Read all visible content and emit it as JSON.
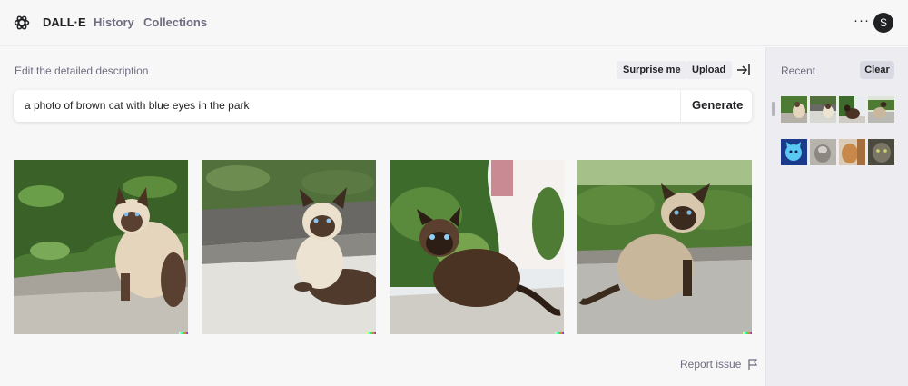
{
  "header": {
    "brand": "DALL·E",
    "nav": [
      "History",
      "Collections"
    ],
    "more_label": "···",
    "avatar_initial": "S"
  },
  "editor": {
    "heading": "Edit the detailed description",
    "surprise_label": "Surprise me",
    "upload_label": "Upload",
    "prompt_value": "a photo of brown cat with blue eyes in the park",
    "generate_label": "Generate"
  },
  "results": [
    {
      "icon": "siamese-cat-in-garden-image"
    },
    {
      "icon": "siamese-cat-on-sidewalk-image"
    },
    {
      "icon": "siamese-cat-near-hedge-image"
    },
    {
      "icon": "siamese-cat-on-pavement-image"
    }
  ],
  "report_label": "Report issue",
  "sidebar": {
    "title": "Recent",
    "clear_label": "Clear"
  },
  "colors": {
    "accent": "#202123",
    "muted_text": "#6e6e80",
    "page_bg": "#f7f7f8",
    "sidebar_bg": "#ececf1"
  }
}
